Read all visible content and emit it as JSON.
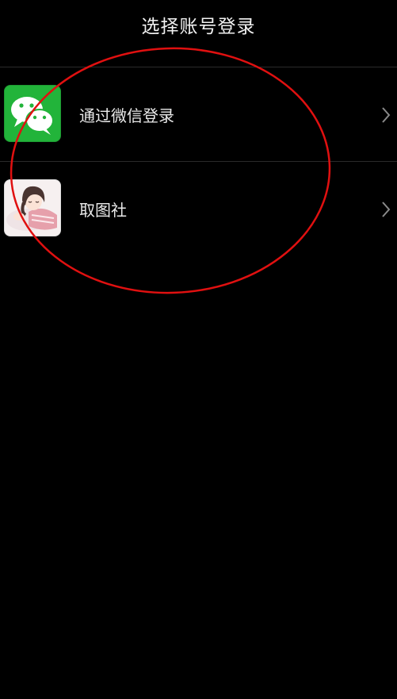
{
  "header": {
    "title": "选择账号登录"
  },
  "accounts": [
    {
      "label": "通过微信登录",
      "icon": "wechat-icon"
    },
    {
      "label": "取图社",
      "icon": "anime-avatar-icon"
    }
  ],
  "colors": {
    "background": "#000000",
    "wechat_green": "#22b43a",
    "annotation_red": "#e01010",
    "divider": "#2a2a2a"
  }
}
